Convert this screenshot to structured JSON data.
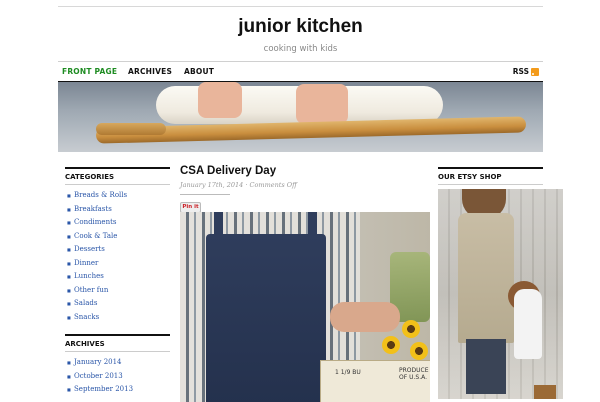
{
  "site": {
    "title": "junior kitchen",
    "tagline": "cooking with kids"
  },
  "nav": {
    "items": [
      {
        "label": "FRONT PAGE",
        "active": true
      },
      {
        "label": "ARCHIVES",
        "active": false
      },
      {
        "label": "ABOUT",
        "active": false
      }
    ],
    "rss_label": "RSS",
    "active_color": "#1e8c22",
    "rss_icon": "rss-feed-icon"
  },
  "sidebar": {
    "categories_title": "CATEGORIES",
    "categories": [
      "Breads & Rolls",
      "Breakfasts",
      "Condiments",
      "Cook & Tale",
      "Desserts",
      "Dinner",
      "Lunches",
      "Other fun",
      "Salads",
      "Snacks"
    ],
    "archives_title": "ARCHIVES",
    "archives": [
      "January 2014",
      "October 2013",
      "September 2013"
    ],
    "link_color": "#2a56a8"
  },
  "post": {
    "title": "CSA Delivery Day",
    "meta": "January 17th, 2014 · Comments Off",
    "pinit_label": "Pin it",
    "box_text_1": "1 1/9 BU",
    "box_text_2": "PRODUCE OF U.S.A."
  },
  "right_sidebar": {
    "etsy_title": "OUR ETSY SHOP"
  }
}
